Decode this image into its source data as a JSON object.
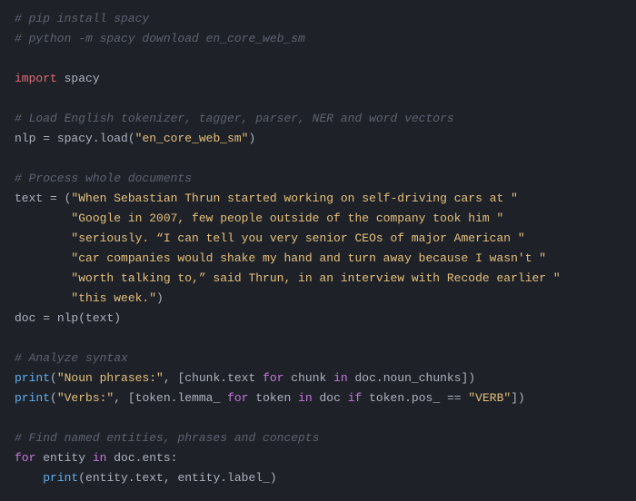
{
  "lines": {
    "l1": "# pip install spacy",
    "l2": "# python -m spacy download en_core_web_sm",
    "l4a": "import",
    "l4b": " spacy",
    "l6": "# Load English tokenizer, tagger, parser, NER and word vectors",
    "l7a": "nlp ",
    "l7b": "=",
    "l7c": " spacy.load(",
    "l7d": "\"en_core_web_sm\"",
    "l7e": ")",
    "l9": "# Process whole documents",
    "l10a": "text ",
    "l10b": "=",
    "l10c": " (",
    "l10d": "\"When Sebastian Thrun started working on self-driving cars at \"",
    "l11": "        \"Google in 2007, few people outside of the company took him \"",
    "l12": "        \"seriously. “I can tell you very senior CEOs of major American \"",
    "l13": "        \"car companies would shake my hand and turn away because I wasn't \"",
    "l14": "        \"worth talking to,” said Thrun, in an interview with Recode earlier \"",
    "l15": "        \"this week.\"",
    "l15b": ")",
    "l16a": "doc ",
    "l16b": "=",
    "l16c": " nlp(text)",
    "l18": "# Analyze syntax",
    "l19a": "print",
    "l19b": "(",
    "l19c": "\"Noun phrases:\"",
    "l19d": ", [chunk.text ",
    "l19e": "for",
    "l19f": " chunk ",
    "l19g": "in",
    "l19h": " doc.noun_chunks])",
    "l20a": "print",
    "l20b": "(",
    "l20c": "\"Verbs:\"",
    "l20d": ", [token.lemma_ ",
    "l20e": "for",
    "l20f": " token ",
    "l20g": "in",
    "l20h": " doc ",
    "l20i": "if",
    "l20j": " token.pos_ ",
    "l20k": "==",
    "l20l": " ",
    "l20m": "\"VERB\"",
    "l20n": "])",
    "l22": "# Find named entities, phrases and concepts",
    "l23a": "for",
    "l23b": " entity ",
    "l23c": "in",
    "l23d": " doc.ents:",
    "l24a": "    ",
    "l24b": "print",
    "l24c": "(entity.text, entity.label_)"
  }
}
